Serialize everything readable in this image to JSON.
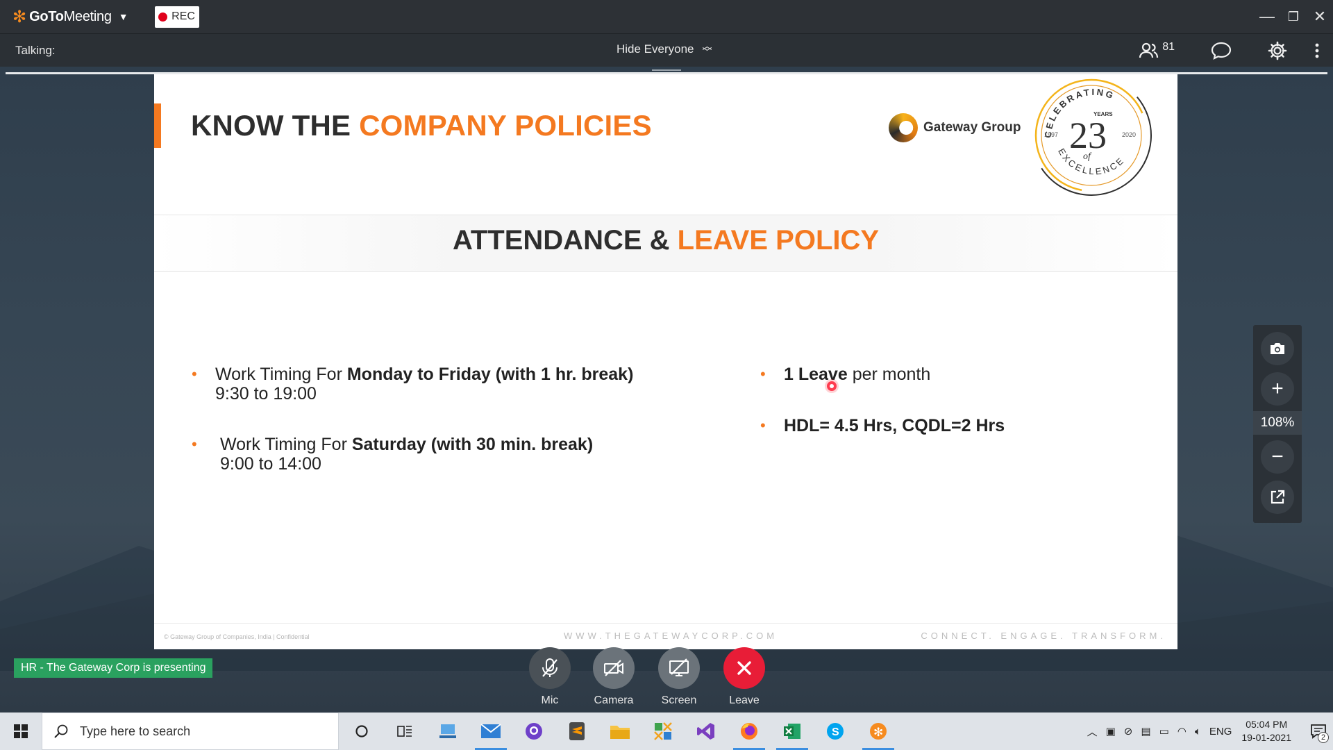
{
  "app": {
    "name_a": "GoTo",
    "name_b": "Meeting",
    "rec_label": "REC"
  },
  "toolbar": {
    "talking_label": "Talking:",
    "hide_everyone_label": "Hide Everyone",
    "attendee_count": "81"
  },
  "slide": {
    "title_part1": "KNOW THE ",
    "title_part2": "COMPANY POLICIES",
    "logo_text": "Gateway Group",
    "seal_top": "CELEBRATING",
    "seal_years": "YEARS",
    "seal_number": "23",
    "seal_start": "1997",
    "seal_end": "2020",
    "seal_of": "of",
    "seal_bottom": "EXCELLENCE",
    "heading_part1": "ATTENDANCE & ",
    "heading_part2": "LEAVE POLICY",
    "left_bullets": [
      {
        "pre": "Work Timing For ",
        "bold": "Monday to Friday (with 1 hr. break)",
        "line2": "9:30 to 19:00"
      },
      {
        "pre": "Work Timing For ",
        "bold": "Saturday (with 30 min. break)",
        "line2": "9:00 to 14:00"
      }
    ],
    "right_bullets": [
      {
        "bold": "1 Leave",
        "post": " per month"
      },
      {
        "bold": "HDL= 4.5 Hrs, CQDL=2 Hrs",
        "post": ""
      }
    ],
    "footer_left": "© Gateway Group of Companies, India | Confidential",
    "footer_center": "WWW.THEGATEWAYCORP.COM",
    "footer_right": "CONNECT. ENGAGE. TRANSFORM."
  },
  "zoom": {
    "percent": "108%"
  },
  "presenting_label": "HR - The Gateway Corp is presenting",
  "controls": {
    "mic": "Mic",
    "camera": "Camera",
    "screen": "Screen",
    "leave": "Leave"
  },
  "taskbar": {
    "search_placeholder": "Type here to search",
    "language": "ENG",
    "time": "05:04 PM",
    "date": "19-01-2021",
    "notification_count": "2"
  },
  "colors": {
    "accent_orange": "#f47920",
    "leave_red": "#e81d37",
    "presenting_green": "#2aa15f"
  }
}
